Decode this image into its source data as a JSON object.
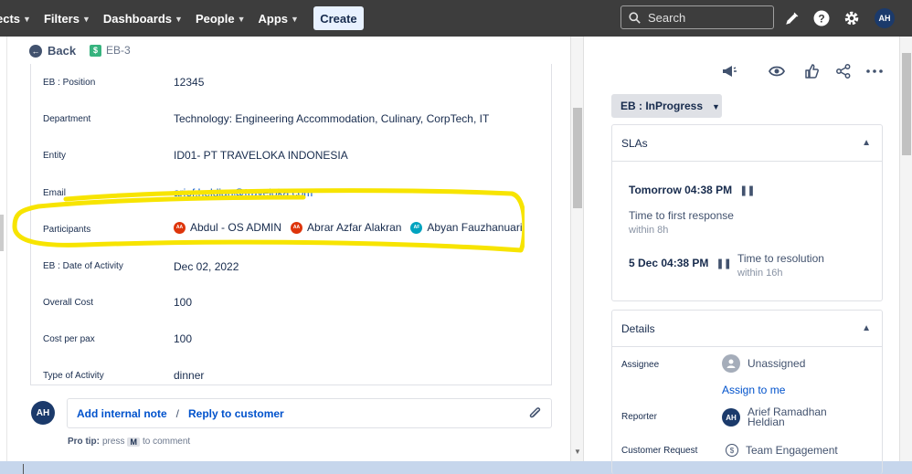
{
  "topnav": {
    "items": [
      {
        "label": "ects"
      },
      {
        "label": "Filters"
      },
      {
        "label": "Dashboards"
      },
      {
        "label": "People"
      },
      {
        "label": "Apps"
      }
    ],
    "create_label": "Create",
    "search_placeholder": "Search",
    "user_initials": "AH"
  },
  "breadcrumb": {
    "back_label": "Back",
    "issue_key": "EB-3"
  },
  "fields": [
    {
      "label": "EB : Position",
      "value": "12345"
    },
    {
      "label": "Department",
      "value": "Technology: Engineering Accommodation, Culinary, CorpTech, IT"
    },
    {
      "label": "Entity",
      "value": "ID01- PT TRAVELOKA INDONESIA"
    },
    {
      "label": "Email",
      "value": "arief.heldian@traveloka.com"
    },
    {
      "label": "Participants",
      "value": ""
    },
    {
      "label": "EB : Date of Activity",
      "value": "Dec 02, 2022"
    },
    {
      "label": "Overall Cost",
      "value": "100"
    },
    {
      "label": "Cost per pax",
      "value": "100"
    },
    {
      "label": "Type of Activity",
      "value": "dinner"
    }
  ],
  "participants": [
    {
      "name": "Abdul - OS ADMIN",
      "initials": "AA",
      "color": "#de350b"
    },
    {
      "name": "Abrar Azfar Alakran",
      "initials": "AA",
      "color": "#de350b"
    },
    {
      "name": "Abyan Fauzhanuari",
      "initials": "AF",
      "color": "#00a3bf"
    }
  ],
  "highlight_color": "#f7e400",
  "comment": {
    "avatar_initials": "AH",
    "internal_note_label": "Add internal note",
    "separator": "/",
    "reply_label": "Reply to customer",
    "pro_tip_label": "Pro tip:",
    "pro_tip_press": "press",
    "pro_tip_key": "M",
    "pro_tip_suffix": "to comment"
  },
  "status": {
    "label": "EB : InProgress"
  },
  "sla": {
    "title": "SLAs",
    "items": [
      {
        "time": "Tomorrow 04:38 PM",
        "goal": "Time to first response",
        "within": "within 8h"
      },
      {
        "time": "5 Dec 04:38 PM",
        "goal": "Time to resolution",
        "within": "within 16h"
      }
    ]
  },
  "details": {
    "title": "Details",
    "assignee_label": "Assignee",
    "assignee_value": "Unassigned",
    "assign_to_me": "Assign to me",
    "reporter_label": "Reporter",
    "reporter_initials": "AH",
    "reporter_name_line1": "Arief Ramadhan",
    "reporter_name_line2": "Heldian",
    "request_label": "Customer Request",
    "request_value": "Team Engagement"
  }
}
